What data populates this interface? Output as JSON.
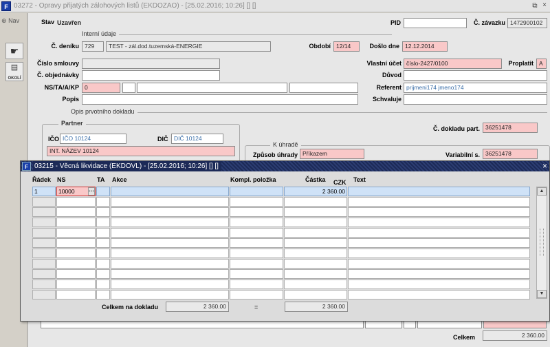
{
  "window": {
    "title": "03272 - Opravy přijatých zálohových listů (EKDOZAO) - [25.02.2016; 10:26]  [] []",
    "restore_icon": "restore-icon"
  },
  "leftbar": {
    "nav_label": "Nav",
    "okoly_label": "OKOLÍ"
  },
  "header": {
    "stav_label": "Stav",
    "stav_value": "Uzavřen",
    "pid_label": "PID",
    "pid_value": "",
    "zavazku_label": "Č. závazku",
    "zavazku_value": "1472900102"
  },
  "interni": {
    "section": "Interní údaje",
    "denik_label": "Č. deníku",
    "denik_code": "729",
    "denik_name": "TEST - zál.dod.tuzemská-ENERGIE",
    "obdobi_label": "Období",
    "obdobi_value": "12/14",
    "doslo_label": "Došlo dne",
    "doslo_value": "12.12.2014"
  },
  "fields": {
    "smlouvy_label": "Číslo smlouvy",
    "smlouvy_value": "",
    "objednavky_label": "Č. objednávky",
    "objednavky_value": "",
    "nsta_label": "NS/TA/A/KP",
    "nsta_value": "0",
    "popis_label": "Popis",
    "popis_value": "",
    "ucet_label": "Vlastní účet",
    "ucet_value": "číslo-2427/0100",
    "proplatit_label": "Proplatit",
    "proplatit_value": "A",
    "duvod_label": "Důvod",
    "duvod_value": "",
    "referent_label": "Referent",
    "referent_value": "prijmeni174 jmeno174",
    "schvaluje_label": "Schvaluje",
    "schvaluje_value": ""
  },
  "opis": {
    "section": "Opis prvotního dokladu",
    "partner_section": "Partner",
    "ico_label": "IČO",
    "ico_value": "IČO 10124",
    "dic_label": "DIČ",
    "dic_value": "DIČ 10124",
    "nazev_value": "INT. NÁZEV 10124",
    "dokladu_label": "Č. dokladu part.",
    "dokladu_value": "36251478",
    "kuhrade_section": "K úhradě",
    "zpusob_label": "Způsob úhrady",
    "zpusob_value": "Příkazem",
    "variabilni_label": "Variabilní s.",
    "variabilni_value": "36251478"
  },
  "footer": {
    "celkem_label": "Celkem",
    "celkem_value": "2 360.00"
  },
  "modal": {
    "title": "03215 - Věcná likvidace (EKDOVL) - [25.02.2016; 10:26]  [] []",
    "close": "×",
    "columns": {
      "radek": "Řádek",
      "ns": "NS",
      "ta": "TA",
      "akce": "Akce",
      "kompl": "Kompl. položka",
      "castka": "Částka",
      "currency": "CZK",
      "text": "Text"
    },
    "rows": [
      {
        "radek": "1",
        "ns": "10000",
        "ta": "",
        "akce": "",
        "kompl": "",
        "castka": "2 360.00",
        "text": ""
      }
    ],
    "ellipsis": "···",
    "total_label": "Celkem na dokladu",
    "total_value": "2 360.00",
    "equals": "=",
    "total_value2": "2 360.00"
  }
}
